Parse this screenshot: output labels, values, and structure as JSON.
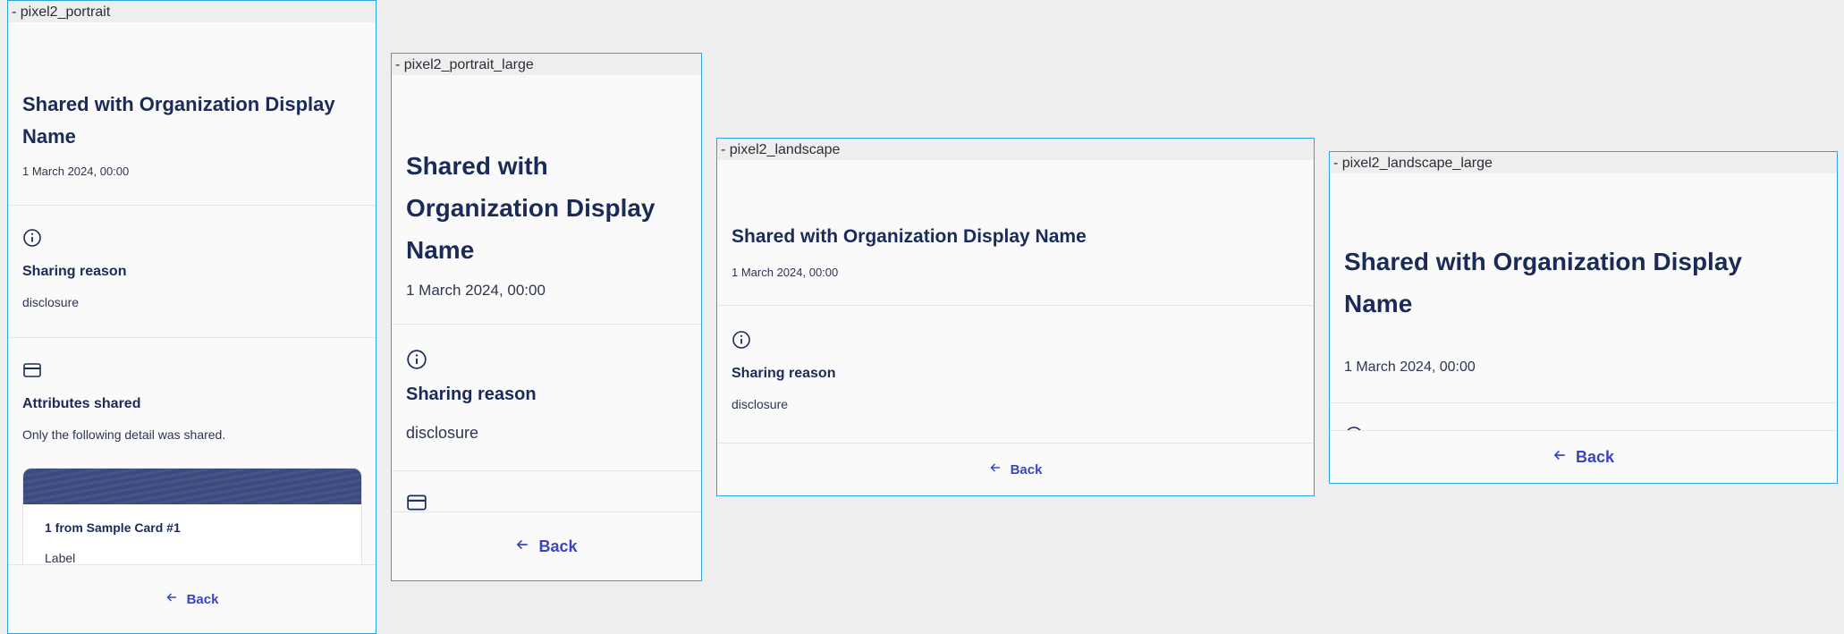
{
  "frames": [
    {
      "label": "- pixel2_portrait",
      "title": "Shared with Organization Display Name",
      "date": "1 March 2024, 00:00",
      "sharing_reason_title": "Sharing reason",
      "sharing_reason_value": "disclosure",
      "attributes_title": "Attributes shared",
      "attributes_subtitle": "Only the following detail was shared.",
      "card_title": "1 from Sample Card #1",
      "card_label": "Label",
      "back_label": "Back"
    },
    {
      "label": "- pixel2_portrait_large",
      "title": "Shared with Organization Display Name",
      "date": "1 March 2024, 00:00",
      "sharing_reason_title": "Sharing reason",
      "sharing_reason_value": "disclosure",
      "back_label": "Back"
    },
    {
      "label": "- pixel2_landscape",
      "title": "Shared with Organization Display Name",
      "date": "1 March 2024, 00:00",
      "sharing_reason_title": "Sharing reason",
      "sharing_reason_value": "disclosure",
      "back_label": "Back"
    },
    {
      "label": "- pixel2_landscape_large",
      "title": "Shared with Organization Display Name",
      "date": "1 March 2024, 00:00",
      "back_label": "Back"
    }
  ],
  "colors": {
    "frame_border": "#2fa3dd",
    "title": "#1b2b58",
    "accent": "#3a45c4",
    "card_banner": "#3b4a7f"
  },
  "icons": {
    "info": "info-circle-icon",
    "card": "credit-card-icon",
    "back": "arrow-left-icon"
  }
}
